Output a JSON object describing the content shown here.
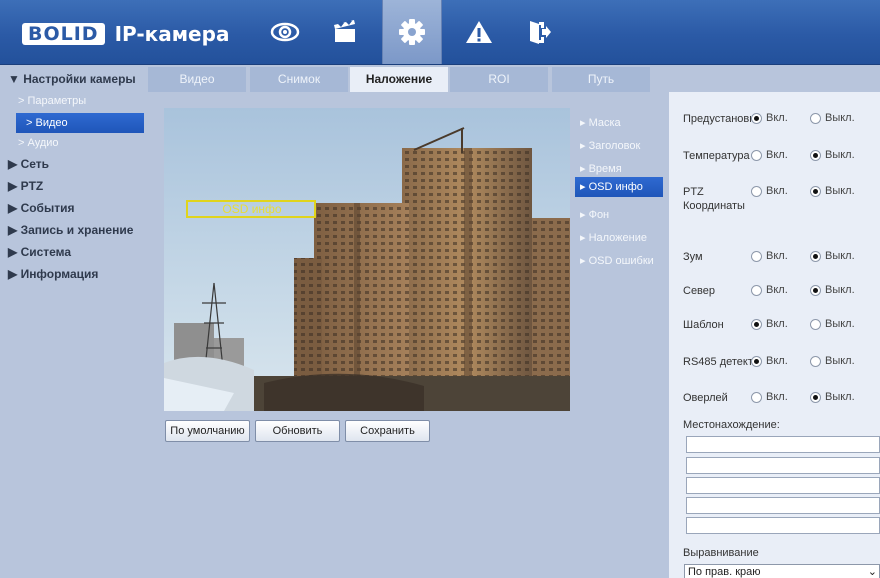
{
  "header": {
    "logo_brand": "BOLID",
    "logo_product": "IP-камера",
    "nav_icons": [
      "eye-icon",
      "clapperboard-icon",
      "gear-icon",
      "warning-icon",
      "exit-icon"
    ],
    "active_nav": "gear-icon",
    "accent_color": "#2b5aa6"
  },
  "sidebar": {
    "items": [
      {
        "label": "▼ Настройки камеры"
      },
      {
        "label": "> Параметры"
      },
      {
        "label": "> Видео"
      },
      {
        "label": "> Аудио"
      },
      {
        "label": "▶ Сеть"
      },
      {
        "label": "▶ PTZ"
      },
      {
        "label": "▶ События"
      },
      {
        "label": "▶ Запись и хранение"
      },
      {
        "label": "▶ Система"
      },
      {
        "label": "▶ Информация"
      }
    ]
  },
  "tabs": [
    "Видео",
    "Снимок",
    "Наложение",
    "ROI",
    "Путь"
  ],
  "active_tab": "Наложение",
  "preview": {
    "osd_label": "OSD инфо"
  },
  "buttons": {
    "default": "По умолчанию",
    "refresh": "Обновить",
    "save": "Сохранить"
  },
  "overlay_menu": [
    "▸ Маска",
    "▸ Заголовок",
    "▸ Время",
    "▸ OSD инфо",
    "▸ Фон",
    "▸ Наложение",
    "▸ OSD ошибки"
  ],
  "overlay_menu_active": "▸ OSD инфо",
  "options": {
    "on_label": "Вкл.",
    "off_label": "Выкл.",
    "rows": [
      {
        "label": "Предустановка",
        "value": "on"
      },
      {
        "label": "Температура",
        "value": "off"
      },
      {
        "label": "PTZ Координаты",
        "value": "off"
      },
      {
        "label": "Зум",
        "value": "off"
      },
      {
        "label": "Север",
        "value": "off"
      },
      {
        "label": "Шаблон",
        "value": "on"
      },
      {
        "label": "RS485 детект",
        "value": "on"
      },
      {
        "label": "Оверлей",
        "value": "off"
      }
    ],
    "location_label": "Местонахождение:",
    "location_lines": [
      "",
      "",
      "",
      "",
      ""
    ],
    "alignment_label": "Выравнивание",
    "alignment_value": "По прав. краю"
  }
}
